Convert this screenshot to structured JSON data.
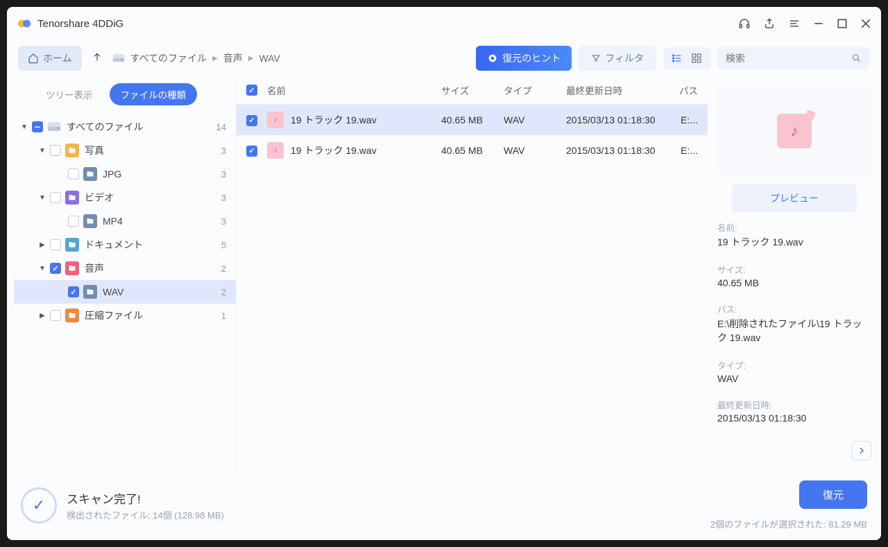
{
  "app": {
    "title": "Tenorshare 4DDiG"
  },
  "toolbar": {
    "home": "ホーム",
    "breadcrumb": [
      "すべてのファイル",
      "音声",
      "WAV"
    ],
    "hint": "復元のヒント",
    "filter": "フィルタ",
    "search_placeholder": "検索"
  },
  "tabs": {
    "tree": "ツリー表示",
    "file_type": "ファイルの種類"
  },
  "tree": [
    {
      "label": "すべてのファイル",
      "count": 14,
      "depth": 0,
      "chk": "minus",
      "ico_bg": "",
      "chevron": "▼",
      "drive": true
    },
    {
      "label": "写真",
      "count": 3,
      "depth": 1,
      "chk": "",
      "ico_bg": "#f5b547",
      "chevron": "▼"
    },
    {
      "label": "JPG",
      "count": 3,
      "depth": 2,
      "chk": "",
      "ico_bg": "#6f8db5",
      "chevron": ""
    },
    {
      "label": "ビデオ",
      "count": 3,
      "depth": 1,
      "chk": "",
      "ico_bg": "#8a6fe8",
      "chevron": "▼"
    },
    {
      "label": "MP4",
      "count": 3,
      "depth": 2,
      "chk": "",
      "ico_bg": "#6f8db5",
      "chevron": ""
    },
    {
      "label": "ドキュメント",
      "count": 5,
      "depth": 1,
      "chk": "",
      "ico_bg": "#4fa7d8",
      "chevron": "▶"
    },
    {
      "label": "音声",
      "count": 2,
      "depth": 1,
      "chk": "checked",
      "ico_bg": "#f0607f",
      "chevron": "▼"
    },
    {
      "label": "WAV",
      "count": 2,
      "depth": 2,
      "chk": "checked",
      "ico_bg": "#6f8db5",
      "chevron": "",
      "selected": true
    },
    {
      "label": "圧縮ファイル",
      "count": 1,
      "depth": 1,
      "chk": "",
      "ico_bg": "#e88b3f",
      "chevron": "▶"
    }
  ],
  "columns": {
    "name": "名前",
    "size": "サイズ",
    "type": "タイプ",
    "date": "最終更新日時",
    "path": "パス"
  },
  "files": [
    {
      "name": "19 トラック 19.wav",
      "size": "40.65 MB",
      "type": "WAV",
      "date": "2015/03/13 01:18:30",
      "path": "E:...",
      "selected": true
    },
    {
      "name": "19 トラック 19.wav",
      "size": "40.65 MB",
      "type": "WAV",
      "date": "2015/03/13 01:18:30",
      "path": "E:...",
      "selected": false
    }
  ],
  "detail": {
    "preview_btn": "プレビュー",
    "labels": {
      "name": "名前:",
      "size": "サイズ:",
      "path": "パス:",
      "type": "タイプ:",
      "date": "最終更新日時:"
    },
    "name": "19 トラック 19.wav",
    "size": "40.65 MB",
    "path": "E:\\削除されたファイル\\19 トラック 19.wav",
    "type": "WAV",
    "date": "2015/03/13 01:18:30"
  },
  "footer": {
    "scan_title": "スキャン完了!",
    "scan_sub": "検出されたファイル:  14個 (128.98 MB)",
    "recover": "復元",
    "selected_info": "2個のファイルが選択された:   81.29 MB"
  }
}
